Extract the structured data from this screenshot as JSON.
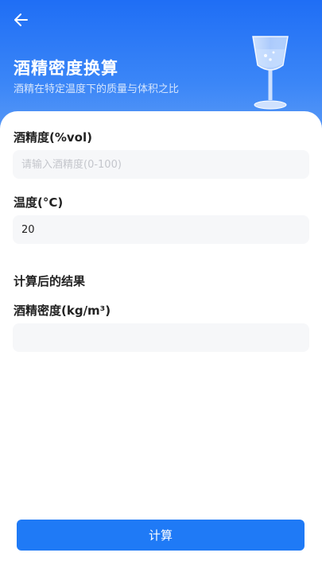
{
  "header": {
    "title": "酒精密度换算",
    "subtitle": "酒精在特定温度下的质量与体积之比"
  },
  "form": {
    "alcohol_label": "酒精度(%vol)",
    "alcohol_placeholder": "请输入酒精度(0-100)",
    "alcohol_value": "",
    "temperature_label": "温度(°C)",
    "temperature_value": "20"
  },
  "result": {
    "section_title": "计算后的结果",
    "density_label": "酒精密度(kg/m³)",
    "density_value": ""
  },
  "actions": {
    "calculate_label": "计算"
  },
  "colors": {
    "primary": "#1f7af6",
    "header_top": "#1f6ef5",
    "field_bg": "#f6f7f9"
  }
}
